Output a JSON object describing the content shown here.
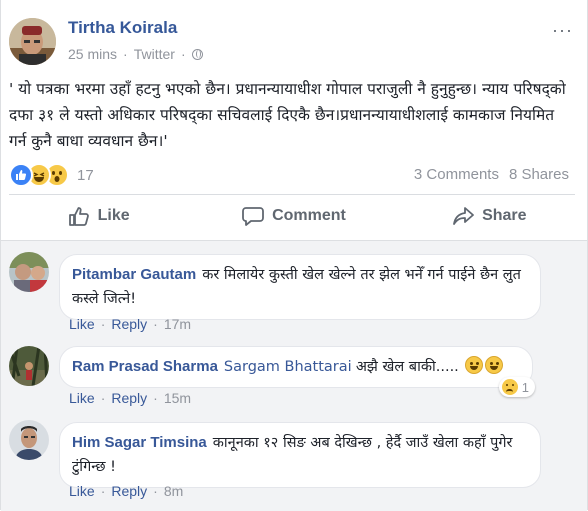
{
  "post": {
    "author": "Tirtha Koirala",
    "time": "25 mins",
    "separator": "·",
    "source": "Twitter",
    "more_label": "···",
    "body": "' यो पत्रका भरमा उहाँ हटनु भएको छैन। प्रधानन्यायाधीश गोपाल पराजुली नै हुनुहुन्छ। न्याय परिषद्को दफा ३१ ले यस्तो अधिकार परिषद्का सचिवलाई दिएकै छैन।प्रधानन्यायाधीशलाई कामकाज नियमित गर्न कुनै बाधा व्यवधान छैन।'",
    "reaction_count": "17",
    "comments_count": "3 Comments",
    "shares_count": "8 Shares",
    "actions": {
      "like": "Like",
      "comment": "Comment",
      "share": "Share"
    }
  },
  "comments": [
    {
      "name": "Pitambar Gautam",
      "text": "कर मिलायेर कुस्ती खेल खेल्ने तर झेल भनेँ गर्न पाईने छैन लुत कस्ले जित्ने!",
      "like": "Like",
      "reply": "Reply",
      "separator": "·",
      "time": "17m"
    },
    {
      "name": "Ram Prasad Sharma",
      "mention": "Sargam Bhattarai",
      "text": "अझै खेल बाकी.....",
      "reaction_count": "1",
      "like": "Like",
      "reply": "Reply",
      "separator": "·",
      "time": "15m"
    },
    {
      "name": "Him Sagar Timsina",
      "text": "कानूनका १२ सिङ अब देखिन्छ , हेर्दै जाउँ खेला कहाँ पुगेर टुंगिन्छ !",
      "like": "Like",
      "reply": "Reply",
      "separator": "·",
      "time": "8m"
    }
  ],
  "colors": {
    "link": "#365899",
    "muted": "#90949c",
    "like_blue": "#3b82f6",
    "emoji_yellow": "#f7c948",
    "comment_bg": "#f2f3f5"
  }
}
